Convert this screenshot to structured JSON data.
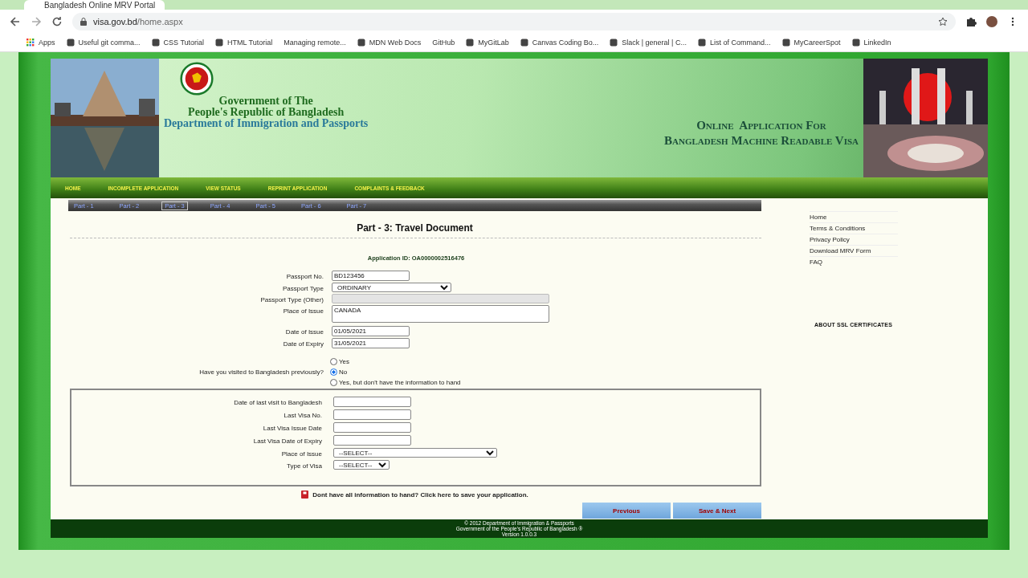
{
  "browser": {
    "tab_title": "Bangladesh Online MRV Portal",
    "url_host": "visa.gov.bd",
    "url_path": "/home.aspx",
    "bookmarks": [
      {
        "label": "Apps",
        "kind": "apps"
      },
      {
        "label": "Useful git comma...",
        "kind": "icon"
      },
      {
        "label": "CSS Tutorial",
        "kind": "icon"
      },
      {
        "label": "HTML Tutorial",
        "kind": "icon"
      },
      {
        "label": "Managing remote...",
        "kind": "plain"
      },
      {
        "label": "MDN Web Docs",
        "kind": "icon"
      },
      {
        "label": "GitHub",
        "kind": "plain"
      },
      {
        "label": "MyGitLab",
        "kind": "icon"
      },
      {
        "label": "Canvas Coding Bo...",
        "kind": "icon"
      },
      {
        "label": "Slack | general | C...",
        "kind": "icon"
      },
      {
        "label": "List of Command...",
        "kind": "icon"
      },
      {
        "label": "MyCareerSpot",
        "kind": "icon"
      },
      {
        "label": "LinkedIn",
        "kind": "icon"
      }
    ]
  },
  "header": {
    "gov_lines": [
      "Government of The",
      "People's Republic of Bangladesh",
      "Department of Immigration and Passports"
    ],
    "app_lines": [
      "Online  Application For",
      "Bangladesh Machine Readable Visa"
    ]
  },
  "nav": [
    "HOME",
    "INCOMPLETE APPLICATION",
    "VIEW STATUS",
    "REPRINT APPLICATION",
    "COMPLAINTS & FEEDBACK"
  ],
  "parts": [
    {
      "label": "Part - 1",
      "selected": false
    },
    {
      "label": "Part - 2",
      "selected": false
    },
    {
      "label": "Part - 3",
      "selected": true
    },
    {
      "label": "Part - 4",
      "selected": false
    },
    {
      "label": "Part - 5",
      "selected": false
    },
    {
      "label": "Part - 6",
      "selected": false
    },
    {
      "label": "Part - 7",
      "selected": false
    }
  ],
  "form": {
    "title": "Part - 3: Travel Document",
    "application_id": "Application ID: OA0000002516476",
    "fields": [
      {
        "label": "Passport No.",
        "kind": "text",
        "value": "BD123456"
      },
      {
        "label": "Passport Type",
        "kind": "select",
        "value": "ORDINARY"
      },
      {
        "label": "Passport Type (Other)",
        "kind": "disabled"
      },
      {
        "label": "Place of Issue",
        "kind": "textarea",
        "value": "CANADA"
      },
      {
        "label": "Date of Issue",
        "kind": "text",
        "value": "01/05/2021"
      },
      {
        "label": "Date of Expiry",
        "kind": "text",
        "value": "31/05/2021"
      }
    ],
    "question": "Have you visited to Bangladesh previously?",
    "options": [
      {
        "label": "Yes",
        "selected": false
      },
      {
        "label": "No",
        "selected": true
      },
      {
        "label": "Yes, but don't have the information to hand",
        "selected": false
      }
    ],
    "previous_visit": [
      {
        "label": "Date of last visit to Bangladesh",
        "kind": "text"
      },
      {
        "label": "Last Visa No.",
        "kind": "text"
      },
      {
        "label": "Last Visa Issue Date",
        "kind": "text"
      },
      {
        "label": "Last Visa Date of Expiry",
        "kind": "text"
      },
      {
        "label": "Place of Issue",
        "kind": "select_wide",
        "value": "--SELECT--"
      },
      {
        "label": "Type of Visa",
        "kind": "select",
        "value": "--SELECT--"
      }
    ],
    "save_note": "Dont have all information to hand? Click here to save your application.",
    "buttons": [
      "Previous",
      "Save & Next"
    ]
  },
  "sidebar": {
    "links": [
      "Home",
      "Terms & Conditions",
      "Privacy Policy",
      "Download MRV Form",
      "FAQ"
    ],
    "ssl": "ABOUT SSL CERTIFICATES"
  },
  "footer": [
    "© 2012 Department of Immigration & Passports",
    "Government of the People's Republic of Bangladesh ®",
    "Version 1.0.0.3"
  ]
}
